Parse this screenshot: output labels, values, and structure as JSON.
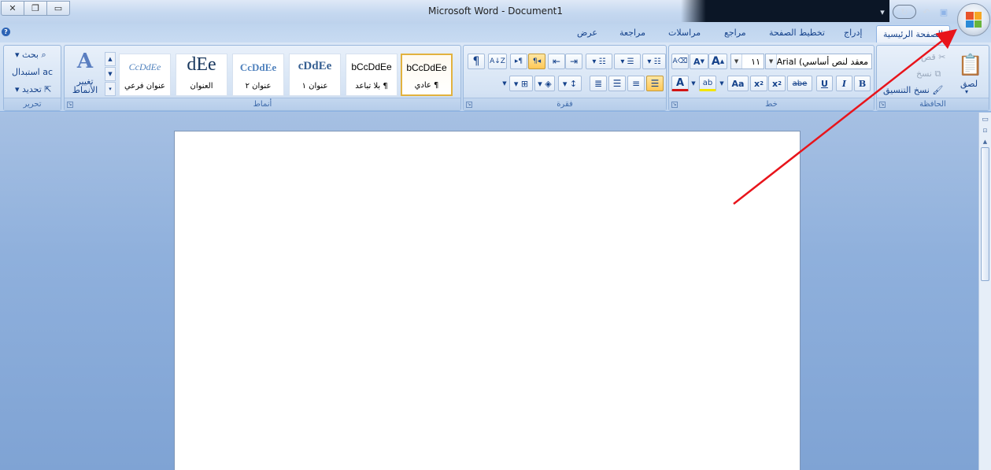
{
  "window": {
    "title": "Microsoft Word - Document1",
    "controls": [
      "close",
      "restore",
      "minimize"
    ]
  },
  "tabs": [
    {
      "label": "الصفحة الرئيسية",
      "active": true
    },
    {
      "label": "إدراج"
    },
    {
      "label": "تخطيط الصفحة"
    },
    {
      "label": "مراجع"
    },
    {
      "label": "مراسلات"
    },
    {
      "label": "مراجعة"
    },
    {
      "label": "عرض"
    }
  ],
  "clipboard": {
    "paste_label": "لصق",
    "cut_label": "قص",
    "copy_label": "نسخ",
    "format_painter_label": "نسخ التنسيق",
    "group_label": "الحافظة"
  },
  "font": {
    "font_name": "معقد لنص أساسي) Arial",
    "font_size": "١١",
    "group_label": "خط",
    "grow_label": "A",
    "shrink_label": "A",
    "bold": "B",
    "italic": "I",
    "underline": "U",
    "strike": "abe",
    "subscript": "x",
    "superscript": "x",
    "change_case": "Aa",
    "highlight_label": "ab",
    "font_color_label": "A"
  },
  "paragraph": {
    "group_label": "فقرة"
  },
  "styles": {
    "group_label": "أنماط",
    "items": [
      {
        "sample": "bCcDdEe",
        "name": "¶ عادي",
        "selected": true
      },
      {
        "sample": "bCcDdEe",
        "name": "¶ بلا تباعد"
      },
      {
        "sample": "cDdEe",
        "name": "عنوان ١"
      },
      {
        "sample": "CcDdEe",
        "name": "عنوان ٢"
      },
      {
        "sample": "dEe",
        "name": "العنوان"
      },
      {
        "sample": "CcDdEe",
        "name": "عنوان فرعي"
      }
    ],
    "change_styles_label": "تغيير الأنماط"
  },
  "editing": {
    "find_label": "بحث",
    "replace_label": "استبدال",
    "select_label": "تحديد",
    "group_label": "تحرير"
  },
  "colors": {
    "annotation_arrow": "#e8141b",
    "selected_style_border": "#e2b23e"
  }
}
